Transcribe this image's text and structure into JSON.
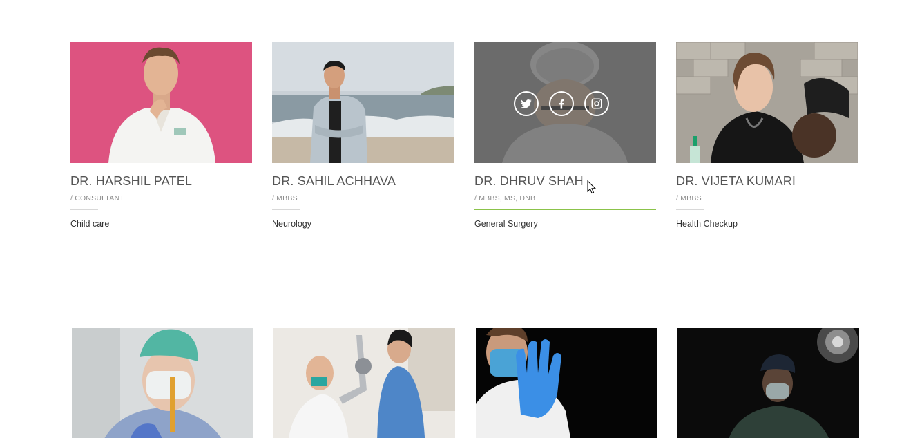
{
  "doctors_row1": [
    {
      "name": "DR. HARSHIL PATEL",
      "role": "/ CONSULTANT",
      "specialty": "Child care"
    },
    {
      "name": "DR. SAHIL ACHHAVA",
      "role": "/ MBBS",
      "specialty": "Neurology"
    },
    {
      "name": "DR. DHRUV SHAH",
      "role": "/ MBBS, MS, DNB",
      "specialty": "General Surgery"
    },
    {
      "name": "DR. VIJETA KUMARI",
      "role": "/ MBBS",
      "specialty": "Health Checkup"
    }
  ],
  "social_icons": [
    "twitter-icon",
    "facebook-icon",
    "instagram-icon"
  ],
  "colors": {
    "accent_line": "#8bc34a",
    "name_text": "#555555",
    "role_text": "#8c8c8c",
    "hover_overlay": "#464646"
  }
}
